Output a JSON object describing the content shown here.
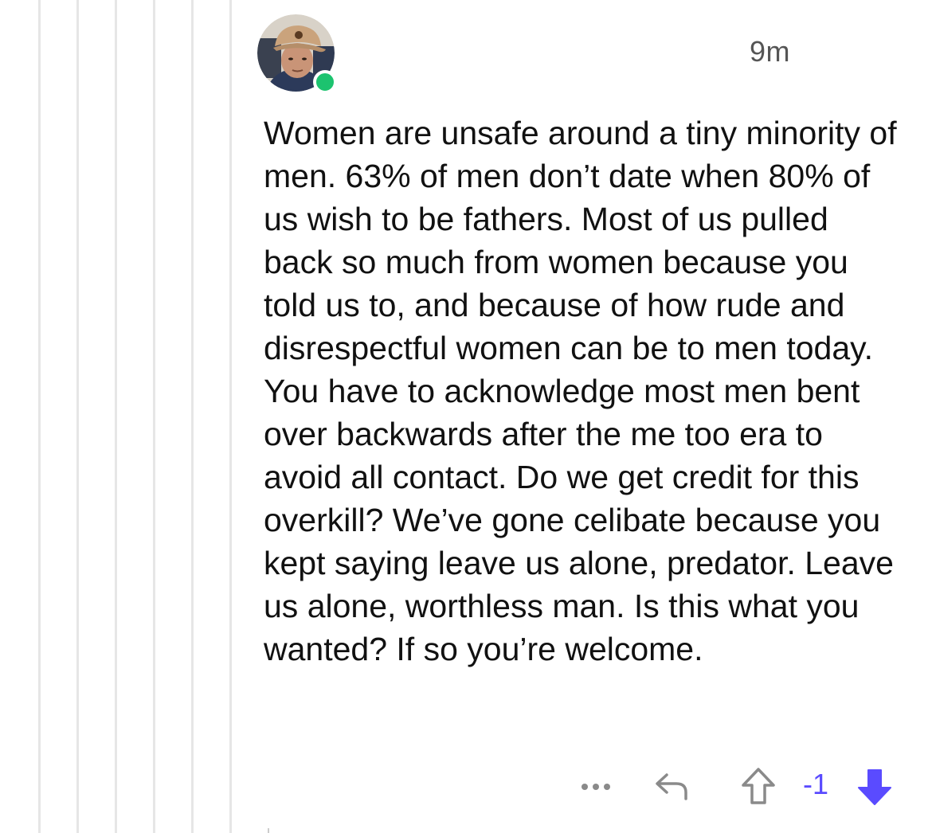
{
  "comment": {
    "timestamp": "9m",
    "online": true,
    "body": "Women are unsafe around a tiny minority of men. 63% of men don’t date when 80% of us wish to be fathers. Most of us pulled back so much from women because you told us to, and because of how rude and disrespectful women can be to men today. You have to acknowledge most men bent over backwards after the me too era to avoid all contact. Do we get credit for this overkill? We’ve gone celibate because you kept saying leave us alone, predator. Leave us alone, worthless man. Is this what you wanted? If so you’re welcome.",
    "score": "-1"
  },
  "actions": {
    "more_icon": "ellipsis-icon",
    "reply_icon": "reply-arrow-icon",
    "upvote_icon": "upvote-outline-arrow-icon",
    "downvote_icon": "downvote-filled-arrow-icon"
  },
  "colors": {
    "accent": "#5a4bff",
    "online": "#1cc36f",
    "thread_line": "#e6e6e6",
    "text": "#111111",
    "muted": "#555555"
  }
}
